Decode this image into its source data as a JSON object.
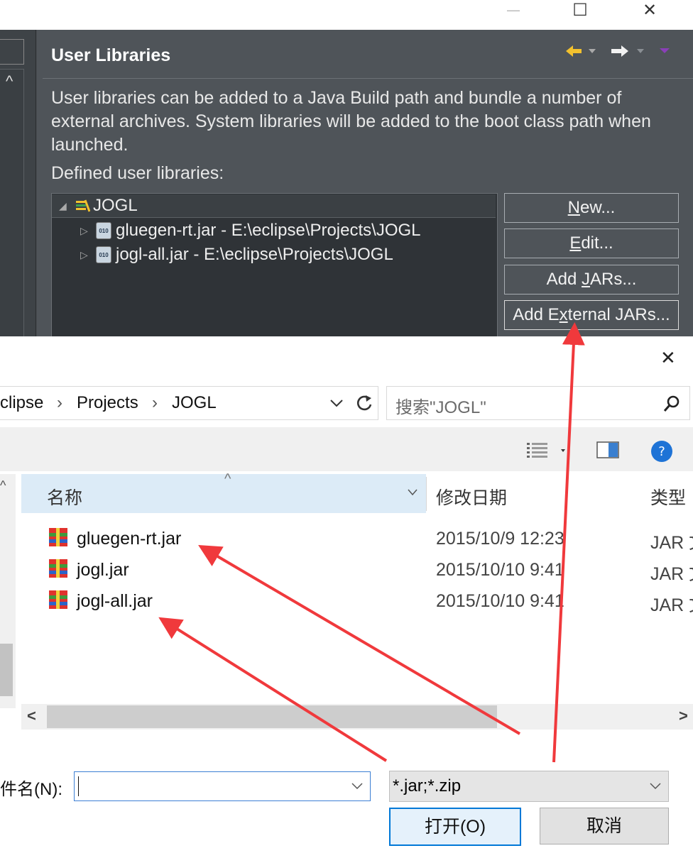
{
  "eclipse": {
    "window_controls": {
      "minimize": "—",
      "maximize": "☐",
      "close": "✕"
    },
    "left_panel_up_arrow": "^",
    "section_title": "User Libraries",
    "description": "User libraries can be added to a Java Build path and bundle a number of external archives. System libraries will be added to the boot class path when launched.",
    "defined_label": "Defined user libraries:",
    "tree": [
      {
        "label": "JOGL",
        "expanded": true,
        "icon": "library-icon"
      },
      {
        "label": "gluegen-rt.jar - E:\\eclipse\\Projects\\JOGL",
        "icon": "jar-icon"
      },
      {
        "label": "jogl-all.jar - E:\\eclipse\\Projects\\JOGL",
        "icon": "jar-icon"
      }
    ],
    "buttons": {
      "new": {
        "pre": "",
        "key": "N",
        "post": "ew..."
      },
      "edit": {
        "pre": "",
        "key": "E",
        "post": "dit..."
      },
      "add_jars": {
        "pre": "Add ",
        "key": "J",
        "post": "ARs..."
      },
      "add_external_jars": {
        "pre": "Add E",
        "key": "x",
        "post": "ternal JARs..."
      }
    },
    "nav_icons": [
      "back-arrow-icon",
      "forward-arrow-icon",
      "view-menu-icon"
    ],
    "colors": {
      "accent_arrow": "#f2c12e",
      "panel_bg": "#4f5459"
    }
  },
  "dialog": {
    "close": "✕",
    "breadcrumb": [
      "clipse",
      "Projects",
      "JOGL"
    ],
    "search_placeholder": "搜索\"JOGL\"",
    "columns": {
      "name": "名称",
      "modified": "修改日期",
      "type": "类型",
      "sort_caret": "^"
    },
    "files": [
      {
        "name": "gluegen-rt.jar",
        "modified": "2015/10/9 12:23",
        "type": "JAR 文"
      },
      {
        "name": "jogl.jar",
        "modified": "2015/10/10 9:41",
        "type": "JAR 文"
      },
      {
        "name": "jogl-all.jar",
        "modified": "2015/10/10 9:41",
        "type": "JAR 文"
      }
    ],
    "filename_label": "件名(N):",
    "filename_value": "",
    "filetype_selected": "*.jar;*.zip",
    "open_button": "打开(O)",
    "cancel_button": "取消",
    "help_glyph": "?",
    "scroll_left": "<",
    "scroll_right": ">",
    "colors": {
      "header_bg": "#dcebf7",
      "help_blue": "#1e73d6",
      "annotation_arrow": "#f0393c"
    }
  }
}
